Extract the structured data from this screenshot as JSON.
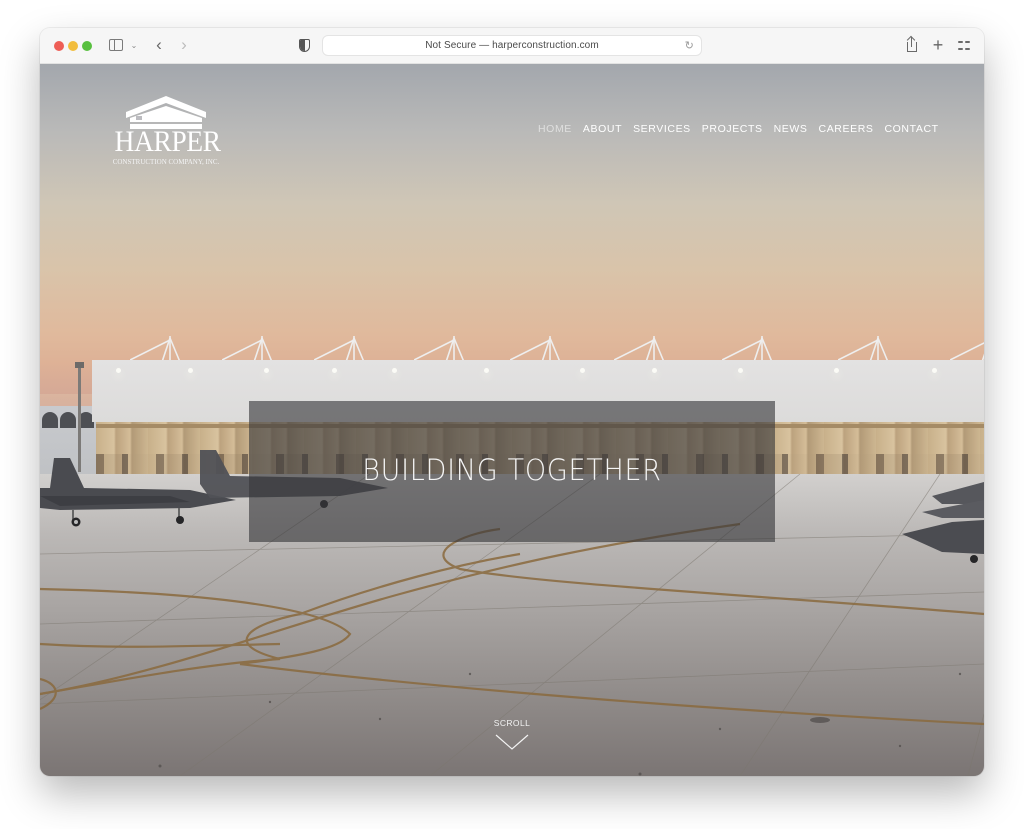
{
  "browser": {
    "url_display": "Not Secure — harperconstruction.com",
    "controls": {
      "close": "close-window",
      "minimize": "minimize-window",
      "zoom": "zoom-window",
      "sidebar": "sidebar-icon",
      "back": "‹",
      "forward": "›",
      "new_tab": "+",
      "reload": "↻"
    },
    "traffic_colors": {
      "close": "#ee5e56",
      "minimize": "#f2bd3d",
      "zoom": "#58c03f"
    }
  },
  "site": {
    "logo": {
      "name": "HARPER",
      "subtitle": "CONSTRUCTION COMPANY, INC."
    },
    "nav": [
      {
        "label": "HOME",
        "active": true
      },
      {
        "label": "ABOUT",
        "active": false
      },
      {
        "label": "SERVICES",
        "active": false
      },
      {
        "label": "PROJECTS",
        "active": false
      },
      {
        "label": "NEWS",
        "active": false
      },
      {
        "label": "CAREERS",
        "active": false
      },
      {
        "label": "CONTACT",
        "active": false
      }
    ],
    "hero": {
      "headline": "BUILDING TOGETHER",
      "scroll_label": "SCROLL"
    }
  }
}
